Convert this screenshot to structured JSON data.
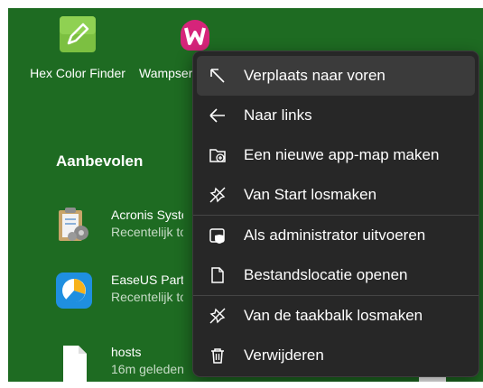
{
  "pinned": [
    {
      "label": "Hex Color Finder",
      "icon": "hex-color-finder-icon"
    },
    {
      "label": "Wampserver",
      "icon": "wampserver-icon"
    }
  ],
  "recommended": {
    "title": "Aanbevolen",
    "items": [
      {
        "name": "Acronis System Report",
        "sub": "Recentelijk toegevoegd",
        "icon": "acronis-clipboard-icon"
      },
      {
        "name": "EaseUS Partition Master",
        "sub": "Recentelijk toegevoegd",
        "icon": "easeus-icon"
      },
      {
        "name": "hosts",
        "sub": "16m geleden",
        "icon": "file-icon"
      }
    ]
  },
  "context_menu": {
    "items": [
      {
        "label": "Verplaats naar voren",
        "icon": "arrow-up-left-icon",
        "hover": true
      },
      {
        "label": "Naar links",
        "icon": "arrow-left-icon"
      },
      {
        "label": "Een nieuwe app-map maken",
        "icon": "new-folder-icon"
      },
      {
        "label": "Van Start losmaken",
        "icon": "unpin-icon"
      },
      {
        "label": "Als administrator uitvoeren",
        "icon": "shield-window-icon"
      },
      {
        "label": "Bestandslocatie openen",
        "icon": "open-file-location-icon"
      },
      {
        "label": "Van de taakbalk losmaken",
        "icon": "unpin-icon"
      },
      {
        "label": "Verwijderen",
        "icon": "trash-icon"
      }
    ]
  },
  "colors": {
    "background": "#1e6b22",
    "menu": "#272727",
    "menu_hover": "#3b3b3b"
  }
}
